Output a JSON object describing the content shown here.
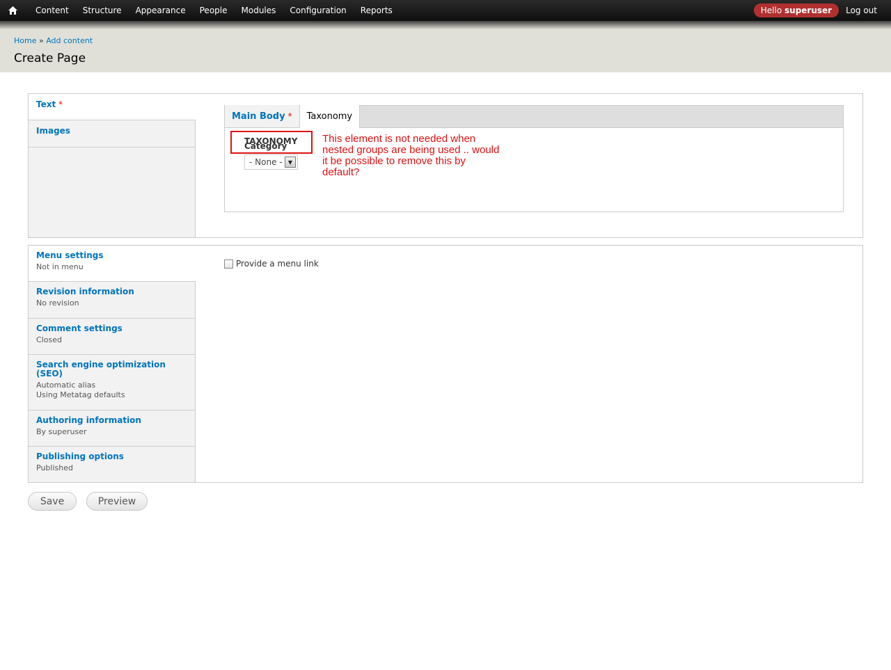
{
  "toolbar": {
    "home_icon": "home-icon",
    "nav": [
      "Content",
      "Structure",
      "Appearance",
      "People",
      "Modules",
      "Configuration",
      "Reports"
    ],
    "hello_prefix": "Hello",
    "username": "superuser",
    "logout": "Log out"
  },
  "header": {
    "breadcrumb": [
      "Home",
      "Add content"
    ],
    "breadcrumb_sep": "»",
    "title": "Create Page"
  },
  "content_tabs": {
    "items": [
      {
        "label": "Text",
        "required": "*"
      },
      {
        "label": "Images"
      }
    ],
    "inner_tabs": [
      {
        "label": "Main Body",
        "required": "*"
      },
      {
        "label": "Taxonomy"
      }
    ],
    "taxonomy_label": "TAXONOMY",
    "category_label": "Category",
    "category_value": "- None -",
    "annotation": "This element is not needed when nested groups are being used .. would it be possible to remove this by default?"
  },
  "settings_tabs": {
    "items": [
      {
        "title": "Menu settings",
        "summary": [
          "Not in menu"
        ]
      },
      {
        "title": "Revision information",
        "summary": [
          "No revision"
        ]
      },
      {
        "title": "Comment settings",
        "summary": [
          "Closed"
        ]
      },
      {
        "title": "Search engine optimization (SEO)",
        "summary": [
          "Automatic alias",
          "Using Metatag defaults"
        ]
      },
      {
        "title": "Authoring information",
        "summary": [
          "By superuser"
        ]
      },
      {
        "title": "Publishing options",
        "summary": [
          "Published"
        ]
      }
    ],
    "menu_checkbox_label": "Provide a menu link"
  },
  "actions": {
    "save": "Save",
    "preview": "Preview"
  },
  "colors": {
    "link": "#0074bd",
    "required": "#ee0000",
    "annotation": "#e01010",
    "hello_badge": "#b03030"
  }
}
